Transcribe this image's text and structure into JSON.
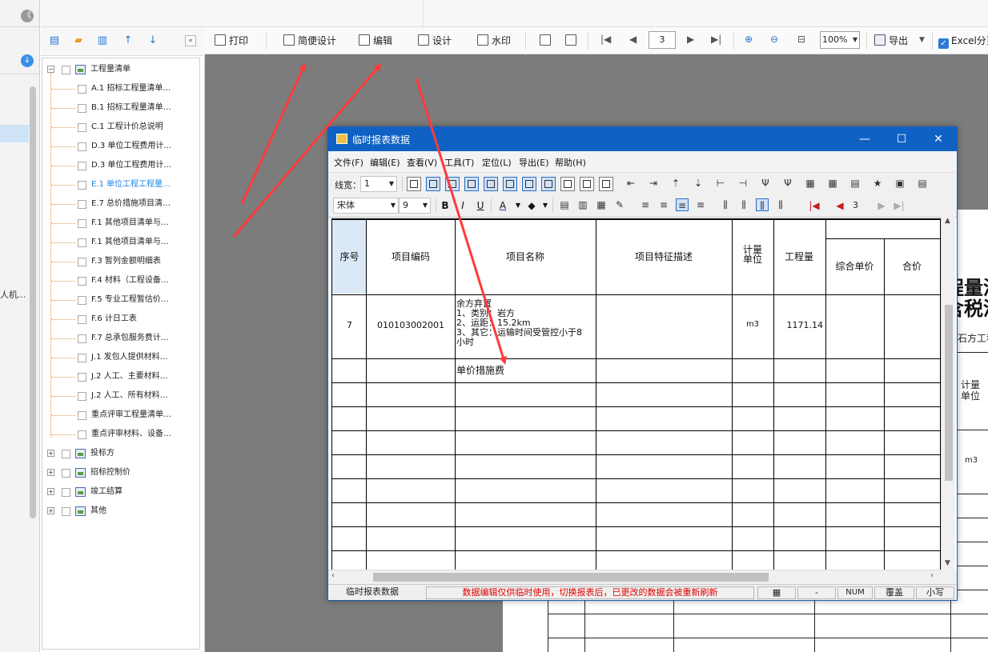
{
  "left": {
    "collapse_glyph": "《",
    "side_text": "人机..."
  },
  "tree": {
    "nodes": [
      {
        "label": "工程量清单",
        "level": 0,
        "expander": "−"
      },
      {
        "label": "A.1 招标工程量清单…",
        "level": 1
      },
      {
        "label": "B.1 招标工程量清单…",
        "level": 1
      },
      {
        "label": "C.1 工程计价总说明",
        "level": 1
      },
      {
        "label": "D.3 单位工程费用计…",
        "level": 1
      },
      {
        "label": "D.3 单位工程费用计…",
        "level": 1
      },
      {
        "label": "E.1 单位工程工程量…",
        "level": 1,
        "selected": true
      },
      {
        "label": "E.7 总价措施项目清…",
        "level": 1
      },
      {
        "label": "F.1 其他项目清单与…",
        "level": 1
      },
      {
        "label": "F.1 其他项目清单与…",
        "level": 1
      },
      {
        "label": "F.3 暂列金额明细表",
        "level": 1
      },
      {
        "label": "F.4 材料（工程设备…",
        "level": 1
      },
      {
        "label": "F.5 专业工程暂估价…",
        "level": 1
      },
      {
        "label": "F.6 计日工表",
        "level": 1
      },
      {
        "label": "F.7 总承包服务费计…",
        "level": 1
      },
      {
        "label": "J.1 发包人提供材料…",
        "level": 1
      },
      {
        "label": "J.2 人工、主要材料…",
        "level": 1
      },
      {
        "label": "J.2 人工、所有材料…",
        "level": 1
      },
      {
        "label": "重点评审工程量清单…",
        "level": 1
      },
      {
        "label": "重点评审材料、设备…",
        "level": 1
      },
      {
        "label": "投标方",
        "level": 0,
        "expander": "+"
      },
      {
        "label": "招标控制价",
        "level": 0,
        "expander": "+"
      },
      {
        "label": "竣工结算",
        "level": 0,
        "expander": "+"
      },
      {
        "label": "其他",
        "level": 0,
        "expander": "+"
      }
    ],
    "selected_color": "#1e88e5"
  },
  "toolbar": {
    "print": "打印",
    "simple_design": "简便设计",
    "edit": "编辑",
    "design": "设计",
    "watermark": "水印",
    "page": "3",
    "zoom": "100%",
    "export": "导出",
    "excel": "Excel分页"
  },
  "dialog": {
    "title": "临时报表数据",
    "menu": [
      "文件(F)",
      "编辑(E)",
      "查看(V)",
      "工具(T)",
      "定位(L)",
      "导出(E)",
      "帮助(H)"
    ],
    "line_width_label": "线宽：",
    "line_width_value": "1",
    "font_name": "宋体",
    "font_size": "9",
    "page_value": "3",
    "headers": {
      "seq": "序号",
      "code": "项目编码",
      "name": "项目名称",
      "desc": "项目特征描述",
      "unit": "计量单位",
      "qty": "工程量",
      "unit_price": "综合单价",
      "total": "合价"
    },
    "row": {
      "seq": "7",
      "code": "010103002001",
      "name_lines": [
        "余方弃置",
        "1、类别：岩方",
        "2、运距：15.2km",
        "3、其它：运输时间受管控小于8",
        "小时"
      ],
      "unit": "m3",
      "qty": "1171.14"
    },
    "measure_row": "单价措施费",
    "status": {
      "name": "临时报表数据",
      "message": "数据编辑仅供临时使用，切换报表后，已更改的数据会被重新刷新",
      "dash": "-",
      "num": "NUM",
      "overwrite": "覆盖",
      "lower": "小写"
    },
    "status_message_color": "#e00000"
  },
  "background_report": {
    "title1": "程量清",
    "title2": "含税清",
    "subtitle": "石方工程",
    "unit_header": "计量单位",
    "unit_value": "m3"
  },
  "arrow_color": "#ff3b3b"
}
